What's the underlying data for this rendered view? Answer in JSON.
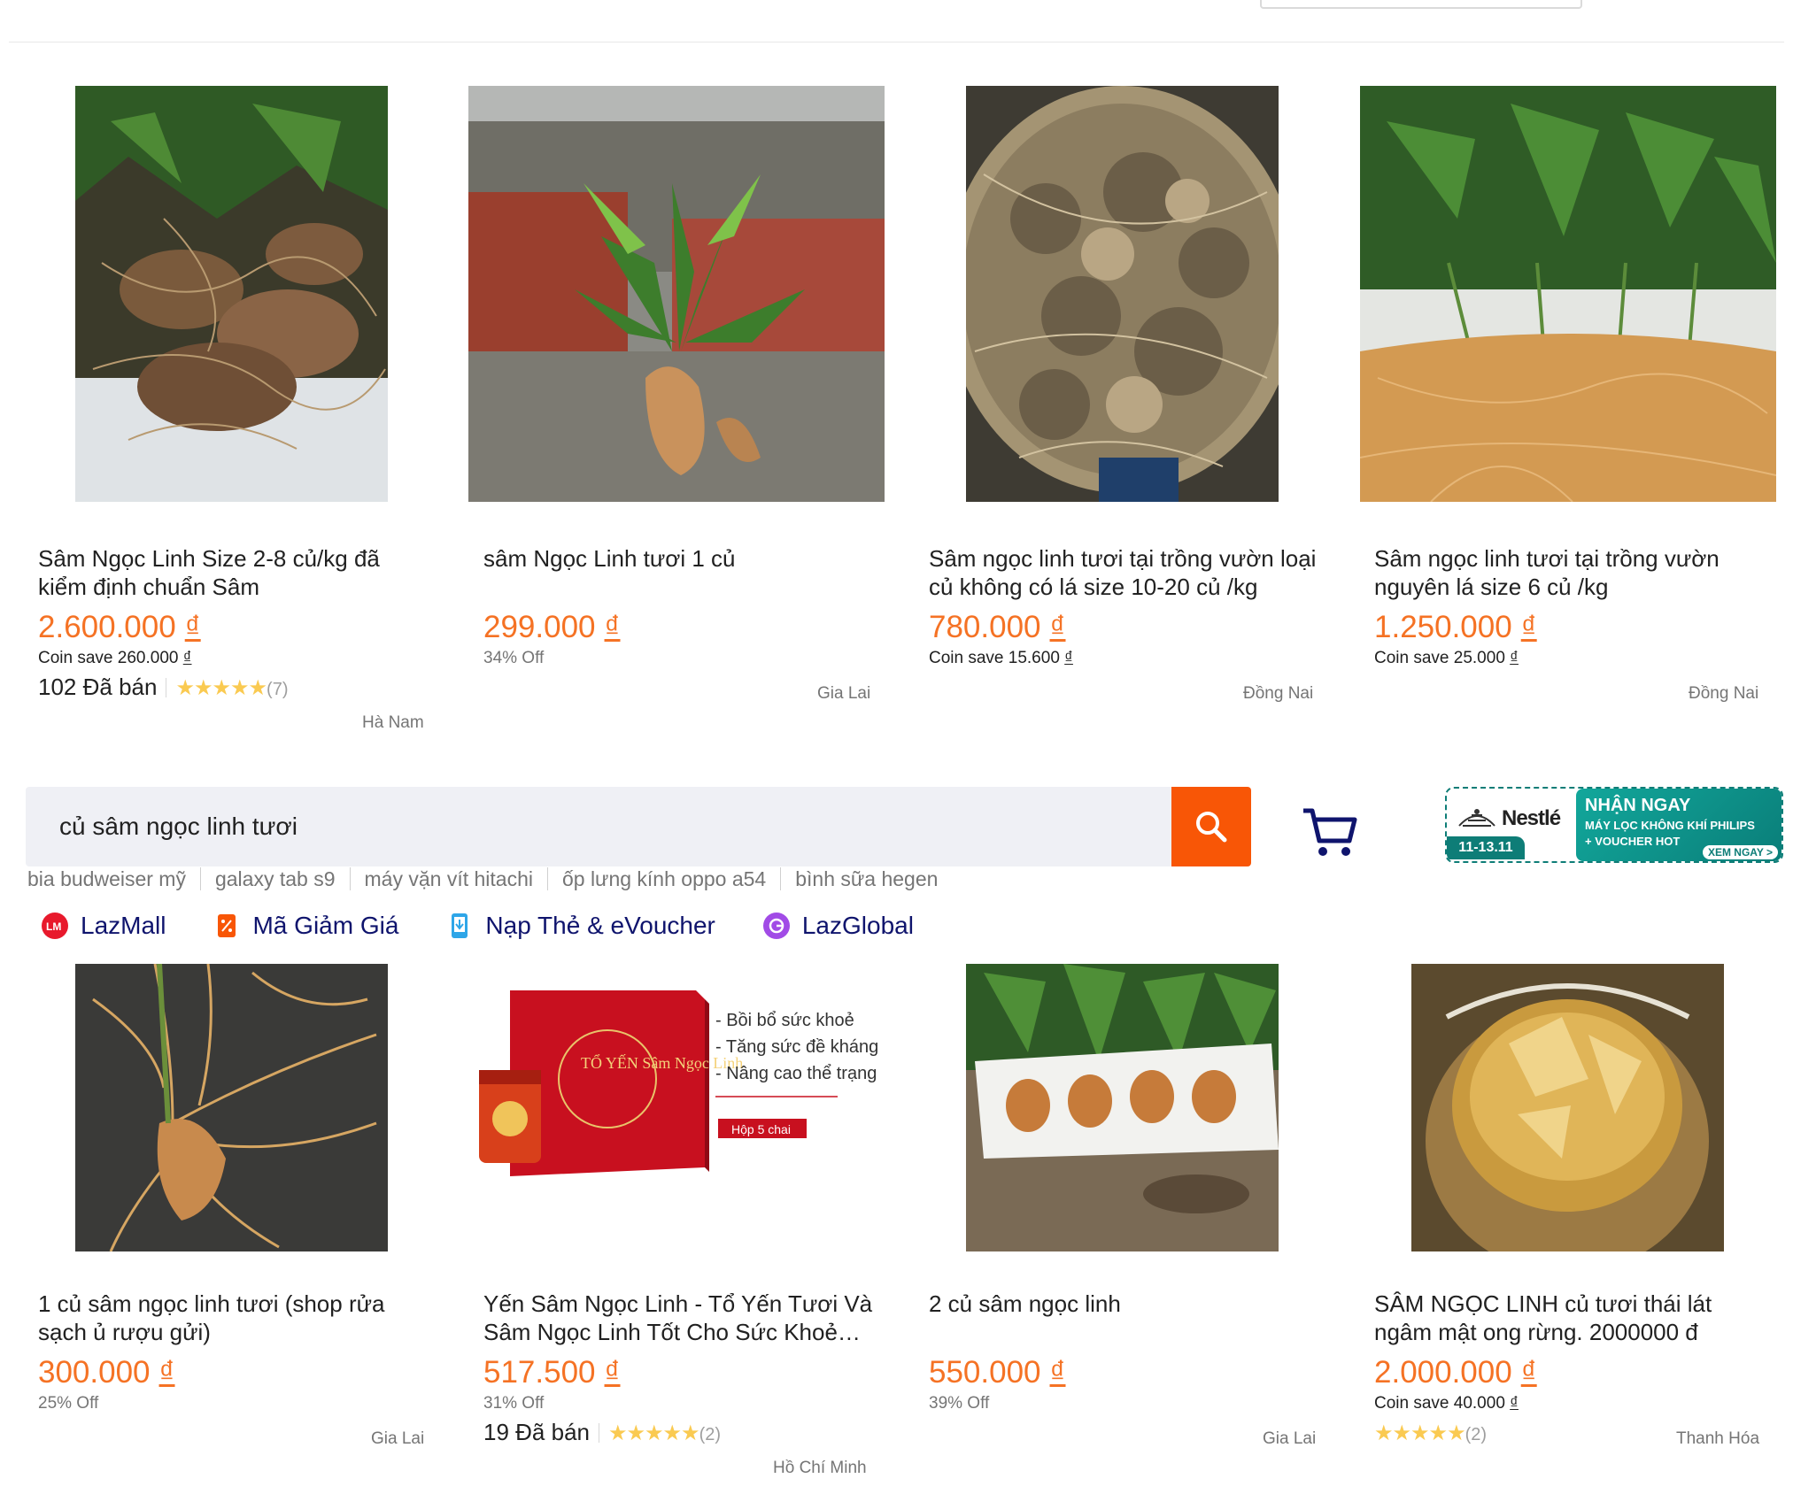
{
  "search": {
    "query": "củ sâm ngọc linh tươi",
    "suggestions": [
      "bia budweiser mỹ",
      "galaxy tab s9",
      "máy vặn vít hitachi",
      "ốp lưng kính oppo a54",
      "bình sữa hegen"
    ]
  },
  "nav_links": [
    "LazMall",
    "Mã Giảm Giá",
    "Nạp Thẻ & eVoucher",
    "LazGlobal"
  ],
  "promo": {
    "brand": "Nestlé",
    "date": "11-13.11",
    "line1": "NHẬN NGAY",
    "line2": "MÁY LỌC KHÔNG KHÍ PHILIPS",
    "line3": "+ VOUCHER HOT",
    "cta": "XEM NGAY >"
  },
  "products_row1": [
    {
      "title": "Sâm Ngọc Linh Size 2-8 củ/kg đã kiểm định chuẩn Sâm",
      "price": "2.600.000",
      "currency": "₫",
      "sub": "Coin save 260.000",
      "sub_currency": "₫",
      "sold": "102 Đã bán",
      "stars": "★★★★★",
      "rating_count": "(7)",
      "location": "Hà Nam"
    },
    {
      "title": "sâm Ngọc Linh tươi 1 củ",
      "price": "299.000",
      "currency": "₫",
      "sub": "34% Off",
      "sub_currency": "",
      "sold": "",
      "stars": "",
      "rating_count": "",
      "location": "Gia Lai"
    },
    {
      "title": "Sâm ngọc linh tươi tại trồng vườn loại củ không có lá size 10-20 củ /kg",
      "price": "780.000",
      "currency": "₫",
      "sub": "Coin save 15.600",
      "sub_currency": "₫",
      "sold": "",
      "stars": "",
      "rating_count": "",
      "location": "Đồng Nai"
    },
    {
      "title": "Sâm ngọc linh tươi tại trồng vườn nguyên lá size 6 củ /kg",
      "price": "1.250.000",
      "currency": "₫",
      "sub": "Coin save 25.000",
      "sub_currency": "₫",
      "sold": "",
      "stars": "",
      "rating_count": "",
      "location": "Đồng Nai"
    }
  ],
  "products_row2": [
    {
      "title": "1 củ sâm ngọc linh tươi (shop rửa sạch ủ rượu gửi)",
      "price": "300.000",
      "currency": "₫",
      "sub": "25% Off",
      "sub_currency": "",
      "sold": "",
      "stars": "",
      "rating_count": "",
      "location": "Gia Lai"
    },
    {
      "title": "Yến Sâm Ngọc Linh - Tổ Yến Tươi Và Sâm Ngọc Linh Tốt Cho Sức Khoẻ…",
      "price": "517.500",
      "currency": "₫",
      "sub": "31% Off",
      "sub_currency": "",
      "sold": "19 Đã bán",
      "stars": "★★★★★",
      "rating_count": "(2)",
      "location": "Hồ Chí Minh"
    },
    {
      "title": "2 củ sâm ngọc linh",
      "price": "550.000",
      "currency": "₫",
      "sub": "39% Off",
      "sub_currency": "",
      "sold": "",
      "stars": "",
      "rating_count": "",
      "location": "Gia Lai"
    },
    {
      "title": "SÂM NGỌC LINH củ tươi thái lát ngâm mật ong rừng. 2000000 đ",
      "price": "2.000.000",
      "currency": "₫",
      "sub": "Coin save 40.000",
      "sub_currency": "₫",
      "sold": "",
      "stars": "★★★★★",
      "rating_count": "(2)",
      "location": "Thanh Hóa"
    }
  ],
  "product_image": {
    "box_lines": [
      "- Bồi bổ sức khoẻ",
      "- Tăng sức đề kháng",
      "- Nâng cao thể trạng"
    ],
    "box_tag": "Hộp 5 chai",
    "box_title": "TỔ YẾN Sâm Ngọc Linh"
  },
  "colors": {
    "price": "#f57224",
    "search_button": "#f85606",
    "nav_text": "#0f146d",
    "star": "#faca51"
  }
}
